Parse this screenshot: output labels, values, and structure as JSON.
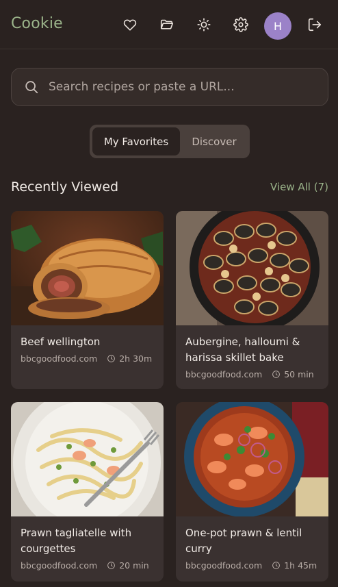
{
  "header": {
    "brand": "Cookie",
    "avatar_initial": "H"
  },
  "search": {
    "placeholder": "Search recipes or paste a URL..."
  },
  "toggle": {
    "active_label": "My Favorites",
    "inactive_label": "Discover"
  },
  "section": {
    "title": "Recently Viewed",
    "view_all": "View All (7)"
  },
  "recipes": [
    {
      "title": "Beef wellington",
      "source": "bbcgoodfood.com",
      "time": "2h 30m",
      "image": "beef-wellington"
    },
    {
      "title": "Aubergine, halloumi & harissa skillet bake",
      "source": "bbcgoodfood.com",
      "time": "50 min",
      "image": "aubergine-skillet"
    },
    {
      "title": "Prawn tagliatelle with courgettes",
      "source": "bbcgoodfood.com",
      "time": "20 min",
      "image": "prawn-tagliatelle"
    },
    {
      "title": "One-pot prawn & lentil curry",
      "source": "bbcgoodfood.com",
      "time": "1h 45m",
      "image": "prawn-lentil-curry"
    }
  ],
  "colors": {
    "background": "#2a2220",
    "accent": "#9bb48a",
    "avatar": "#9b82c8",
    "card": "#3a3130"
  },
  "icons": [
    "heart-icon",
    "folder-icon",
    "sun-icon",
    "gear-icon",
    "logout-icon",
    "search-icon",
    "clock-icon"
  ]
}
